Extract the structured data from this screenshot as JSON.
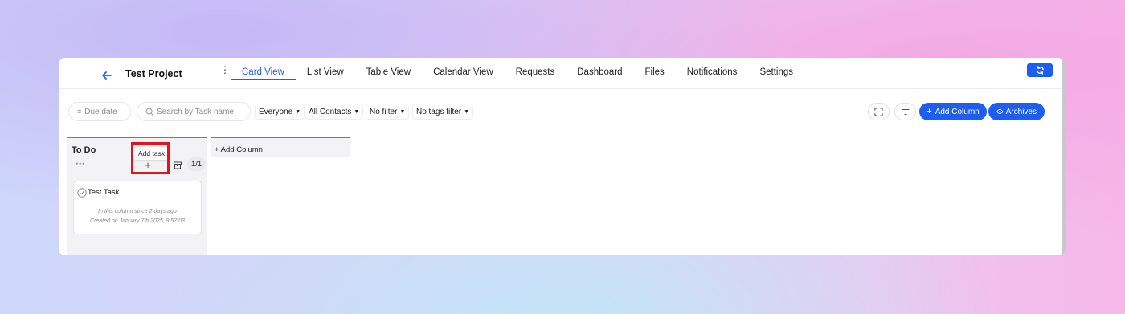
{
  "header": {
    "project_title": "Test Project",
    "tabs": [
      {
        "label": "Card View",
        "active": true
      },
      {
        "label": "List View",
        "active": false
      },
      {
        "label": "Table View",
        "active": false
      },
      {
        "label": "Calendar View",
        "active": false
      },
      {
        "label": "Requests",
        "active": false
      },
      {
        "label": "Dashboard",
        "active": false
      },
      {
        "label": "Files",
        "active": false
      },
      {
        "label": "Notifications",
        "active": false
      },
      {
        "label": "Settings",
        "active": false
      }
    ],
    "refresh_icon": "refresh-icon"
  },
  "toolbar": {
    "due_date_label": "Due date",
    "search_placeholder": "Search by Task name",
    "filters": [
      "Everyone",
      "All Contacts",
      "No filter",
      "No tags filter"
    ],
    "add_column_label": "Add Column",
    "archives_label": "Archives"
  },
  "board": {
    "columns": [
      {
        "title": "To Do",
        "count": "1/1",
        "add_task_tooltip": "Add task",
        "tasks": [
          {
            "name": "Test Task",
            "in_column_since": "In this column since 2 days ago",
            "created_on": "Created on January 7th 2025, 9:57:03"
          }
        ]
      }
    ],
    "add_column_label": "+ Add Column"
  },
  "colors": {
    "accent": "#1d5ef0",
    "column_border": "#3b82f6",
    "highlight": "#e4131d"
  }
}
